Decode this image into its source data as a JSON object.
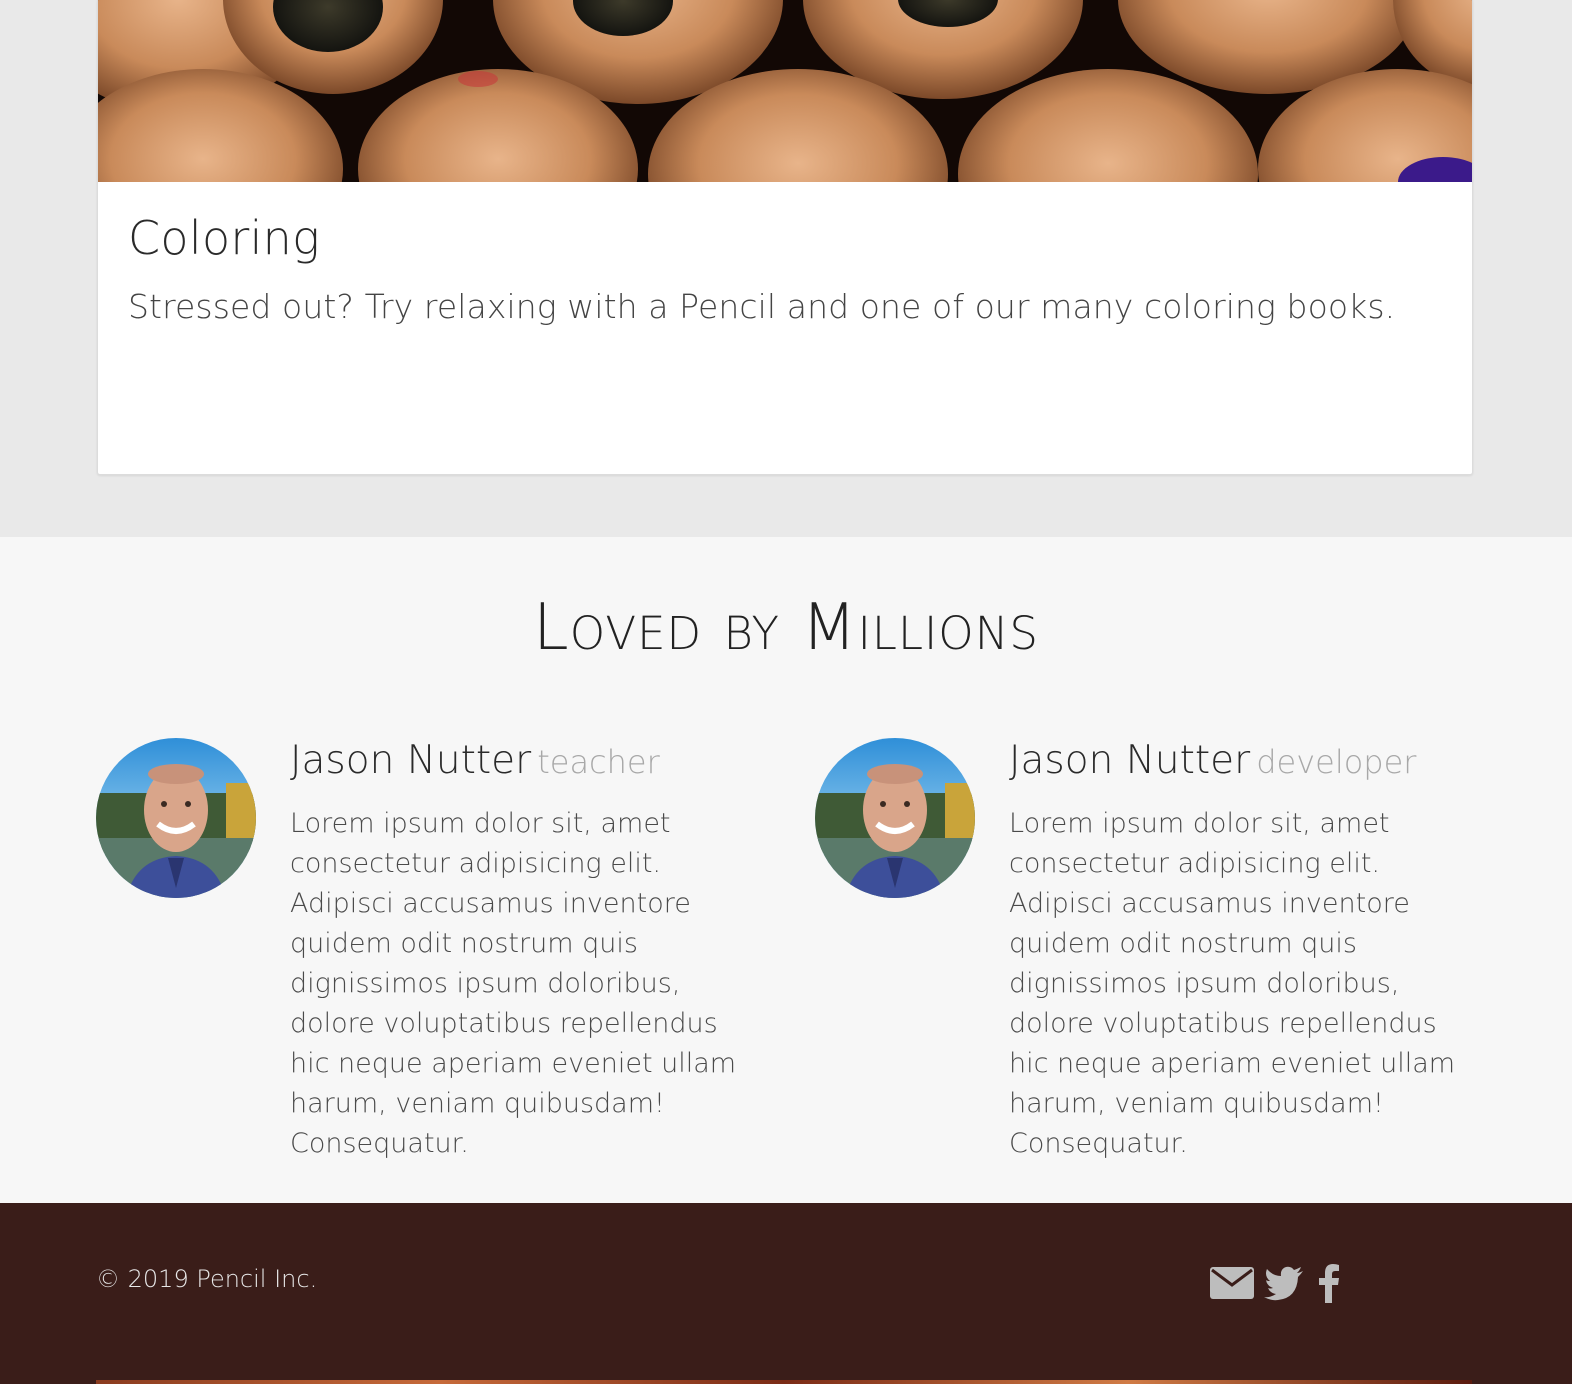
{
  "card": {
    "image_name": "colored pencils photo",
    "title": "Coloring",
    "text": "Stressed out? Try relaxing with a Pencil and one of our many coloring books."
  },
  "testimonials": {
    "heading": "Loved by Millions",
    "people": [
      {
        "name": "Jason Nutter",
        "role": "teacher",
        "text": "Lorem ipsum dolor sit, amet consectetur adipisicing elit. Adipisci accusamus inventore quidem odit nostrum quis dignissimos ipsum doloribus, dolore voluptatibus repellendus hic neque aperiam eveniet ullam harum, veniam quibusdam! Consequatur."
      },
      {
        "name": "Jason Nutter",
        "role": "developer",
        "text": "Lorem ipsum dolor sit, amet consectetur adipisicing elit. Adipisci accusamus inventore quidem odit nostrum quis dignissimos ipsum doloribus, dolore voluptatibus repellendus hic neque aperiam eveniet ullam harum, veniam quibusdam! Consequatur."
      }
    ]
  },
  "footer": {
    "copyright": "© 2019 Pencil Inc.",
    "social_icons": [
      "envelope-icon",
      "twitter-icon",
      "facebook-icon"
    ]
  },
  "colors": {
    "page_bg": "#e9e9e9",
    "section_bg": "#f7f7f7",
    "footer_bg": "#3a1d19",
    "icon_gray": "#bdbdbd"
  }
}
